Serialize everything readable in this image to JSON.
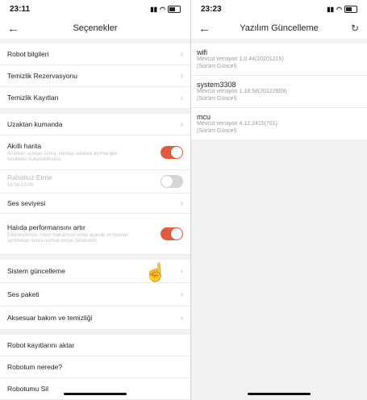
{
  "left": {
    "status_time": "23:11",
    "title": "Seçenekler",
    "items": {
      "robot_info": "Robot bilgileri",
      "cleaning_reservation": "Temizlik Rezervasyonu",
      "cleaning_records": "Temizlik Kayıtları",
      "remote_control": "Uzaktan kumanda",
      "smart_map": "Akıllı harita",
      "smart_map_desc": "Anahtarı açıktan sonra, haritayı odalara ayırma gibi özellikleri kullanabilirsiniz",
      "dnd": "Rahatsız Etme",
      "dnd_time": "14:58-15:06",
      "volume": "Ses seviyesi",
      "carpet": "Halıda performansını artır",
      "carpet_desc": "Etkinleştirince, robot maksimum emişi açacak ve halıdan ayrıldıktan sonra normal emişe dönecektir.",
      "system_update": "Sistem güncelleme",
      "voice_pack": "Ses paketi",
      "accessory_care": "Aksesuar bakım ve temizliği",
      "transfer_logs": "Robot kayıtlarını aktar",
      "where_robot": "Robotum nerede?",
      "delete_robot": "Robotumu Sil"
    },
    "toggles": {
      "smart_map": true,
      "dnd": false,
      "carpet": true
    }
  },
  "right": {
    "status_time": "23:23",
    "title": "Yazılım Güncelleme",
    "versions": [
      {
        "name": "wifi",
        "line": "Mevcut versiyon 1.0.44(20201215)",
        "status": "(Sürüm Güncel)"
      },
      {
        "name": "system3308",
        "line": "Mevcut versiyon 1.18.58(20122609)",
        "status": "(Sürüm Güncel)"
      },
      {
        "name": "mcu",
        "line": "Mevcut versiyon 4.12.2415(701)",
        "status": "(Sürüm Güncel)"
      }
    ]
  },
  "icons": {
    "back": "←",
    "chevron": "›",
    "refresh": "↻",
    "cursor": "☝"
  },
  "colors": {
    "toggle_on": "#e45a3f",
    "toggle_off": "#d5d5d5",
    "background": "#f2f2f2"
  }
}
